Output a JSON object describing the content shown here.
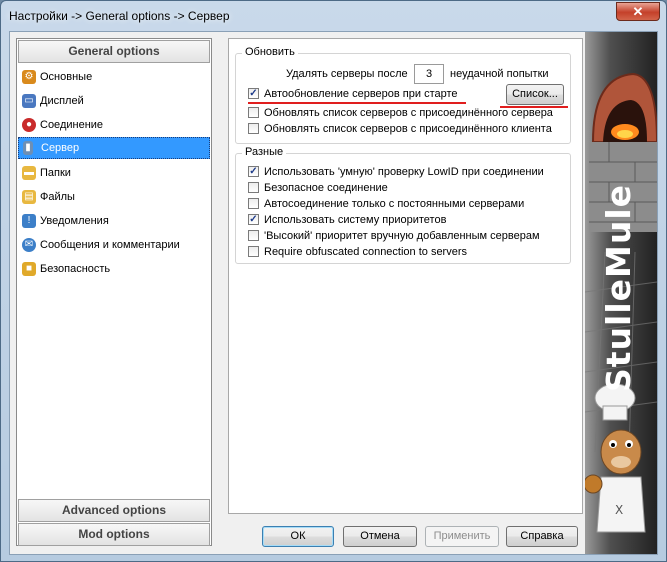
{
  "window": {
    "title": "Настройки -> General options -> Сервер",
    "close_glyph": "✕"
  },
  "nav": {
    "general_header": "General options",
    "items": [
      {
        "label": "Основные",
        "icon": "gear-icon",
        "color": "#d98a1c"
      },
      {
        "label": "Дисплей",
        "icon": "monitor-icon",
        "color": "#4a78c0"
      },
      {
        "label": "Соединение",
        "icon": "connection-icon",
        "color": "#c92b2b"
      },
      {
        "label": "Сервер",
        "icon": "server-icon",
        "color": "#6d8fb5"
      },
      {
        "label": "Папки",
        "icon": "folder-icon",
        "color": "#e8b840"
      },
      {
        "label": "Файлы",
        "icon": "files-icon",
        "color": "#e8b840"
      },
      {
        "label": "Уведомления",
        "icon": "notification-icon",
        "color": "#3c7fc8"
      },
      {
        "label": "Сообщения и комментарии",
        "icon": "messages-icon",
        "color": "#3c7fc8"
      },
      {
        "label": "Безопасность",
        "icon": "lock-icon",
        "color": "#e0a92a"
      }
    ],
    "selected_index": 3,
    "advanced_header": "Advanced options",
    "mod_header": "Mod options"
  },
  "update_group": {
    "title": "Обновить",
    "remove_label_before": "Удалять серверы после",
    "remove_count": "3",
    "remove_label_after": "неудачной попытки",
    "list_button": "Список...",
    "checks": [
      {
        "label": "Автообновление серверов при старте",
        "checked": true
      },
      {
        "label": "Обновлять список серверов с присоединённого сервера",
        "checked": false
      },
      {
        "label": "Обновлять список серверов с присоединённого клиента",
        "checked": false
      }
    ]
  },
  "misc_group": {
    "title": "Разные",
    "checks": [
      {
        "label": "Использовать 'умную' проверку LowID при соединении",
        "checked": true
      },
      {
        "label": "Безопасное соединение",
        "checked": false
      },
      {
        "label": "Автосоединение только с постоянными серверами",
        "checked": false
      },
      {
        "label": "Использовать систему приоритетов",
        "checked": true
      },
      {
        "label": "'Высокий' приоритет вручную добавленным серверам",
        "checked": false
      },
      {
        "label": "Require obfuscated connection to servers",
        "checked": false
      }
    ]
  },
  "buttons": {
    "ok": "ОК",
    "cancel": "Отмена",
    "apply": "Применить",
    "help": "Справка"
  },
  "banner": {
    "brand_text": "StulleMule"
  },
  "colors": {
    "selection": "#3399ff",
    "annotation": "#e01e1e"
  }
}
